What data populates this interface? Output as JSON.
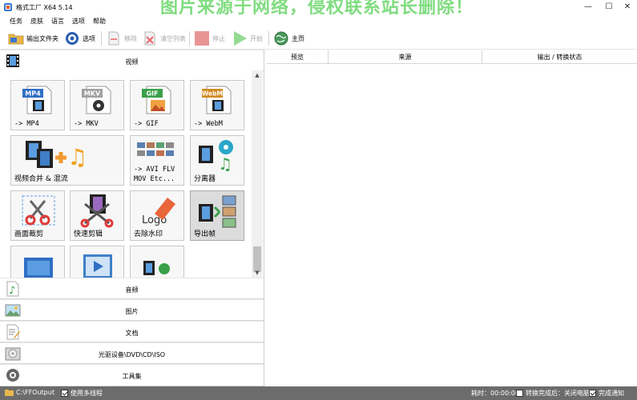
{
  "window": {
    "title": "格式工厂 X64 5.14",
    "watermark": "图片来源于网络，侵权联系站长删除！",
    "controls": {
      "minimize": "—",
      "maximize": "☐",
      "close": "✕"
    }
  },
  "menu": {
    "items": [
      {
        "label": "任务"
      },
      {
        "label": "皮肤"
      },
      {
        "label": "语言"
      },
      {
        "label": "选项"
      },
      {
        "label": "帮助"
      }
    ]
  },
  "toolbar": {
    "output_folder": "输出文件夹",
    "options": "选项",
    "remove": "移除",
    "clear_list": "清空列表",
    "stop": "停止",
    "start": "开始",
    "home": "主页"
  },
  "categories": {
    "video": "视频",
    "audio": "音频",
    "picture": "图片",
    "document": "文档",
    "disc": "光驱设备\\DVD\\CD\\ISO",
    "tools": "工具集"
  },
  "tiles": {
    "mp4": {
      "badge": "MP4",
      "label": "-> MP4"
    },
    "mkv": {
      "badge": "MKV",
      "label": "-> MKV"
    },
    "gif": {
      "badge": "GIF",
      "label": "-> GIF"
    },
    "webm": {
      "badge": "WebM",
      "label": "-> WebM"
    },
    "merge": {
      "label": "视频合并 & 混流"
    },
    "avi": {
      "line1": "-> AVI FLV",
      "line2": "MOV Etc..."
    },
    "splitter": {
      "label": "分离器"
    },
    "crop": {
      "label": "画面裁剪"
    },
    "quick_clip": {
      "label": "快速剪辑"
    },
    "watermark_remove": {
      "label": "去除水印",
      "logo_text": "Logo"
    },
    "export_frames": {
      "label": "导出帧"
    }
  },
  "task_table": {
    "columns": [
      "预览",
      "来源",
      "输出 / 转换状态"
    ]
  },
  "statusbar": {
    "output_path": "C:\\FFOutput",
    "multithread": "使用多线程",
    "elapsed": "耗时：00:00:00",
    "after_convert": "转换完成后：关闭电脑",
    "notify": "完成通知"
  },
  "colors": {
    "mp4_badge": "#2f6fc4",
    "mkv_badge": "#a0a0a0",
    "gif_badge": "#3aa04a",
    "webm_badge": "#d28a20",
    "watermark": "#7fdc7f",
    "statusbar_bg": "#6c6c6c",
    "stop_red": "#e06666",
    "start_green": "#6fcf6f"
  }
}
